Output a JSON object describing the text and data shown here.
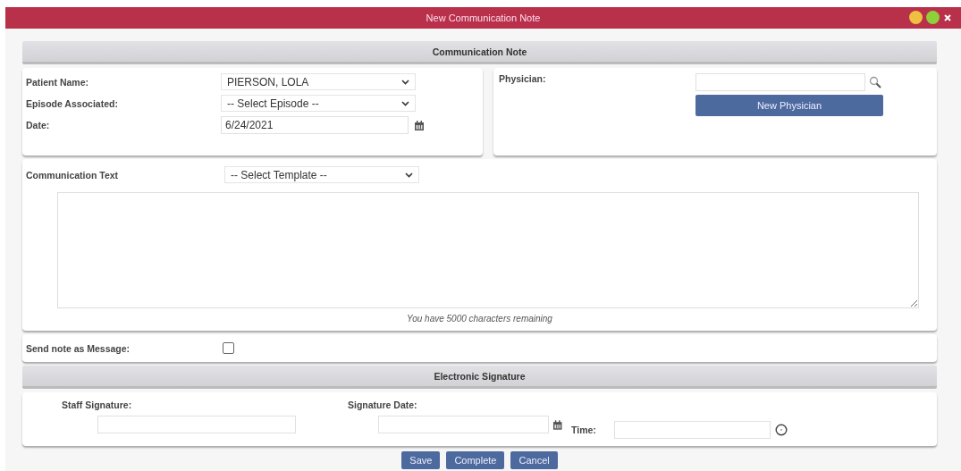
{
  "window": {
    "title": "New Communication Note"
  },
  "note_header": "Communication Note",
  "patient": {
    "label": "Patient Name:",
    "value": "PIERSON, LOLA"
  },
  "episode": {
    "label": "Episode Associated:",
    "value": "-- Select Episode --"
  },
  "date": {
    "label": "Date:",
    "value": "6/24/2021"
  },
  "physician": {
    "label": "Physician:",
    "button": "New Physician"
  },
  "communication": {
    "label": "Communication Text",
    "template": "-- Select Template --",
    "remaining": "You have 5000 characters remaining"
  },
  "send_message": {
    "label": "Send note as Message:",
    "checked": false
  },
  "signature_header": "Electronic Signature",
  "signature": {
    "staff_label": "Staff Signature:",
    "date_label": "Signature Date:",
    "time_label": "Time:"
  },
  "buttons": [
    "Save",
    "Complete",
    "Cancel"
  ]
}
